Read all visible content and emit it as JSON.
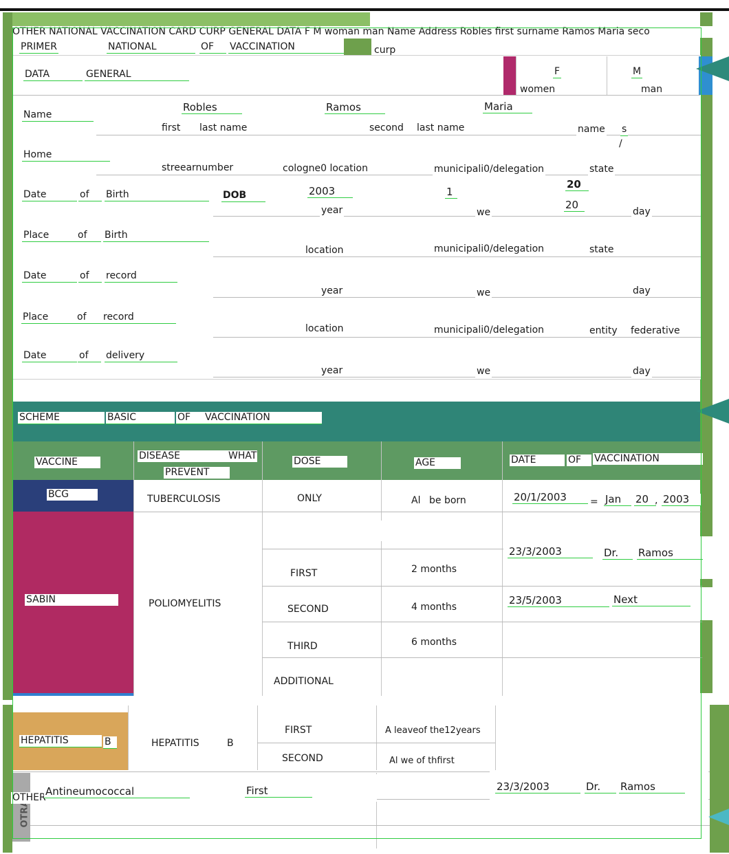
{
  "header": {
    "ocr_line": "OTHER NATIONAL VACCINATION CARD CURP GENERAL DATA F M woman man Name Address Robles first surname Ramos Maria seco",
    "title_words": [
      "PRIMER",
      "NATIONAL",
      "OF",
      "VACCINATION"
    ],
    "curp": "curp"
  },
  "general_data": {
    "label_words": [
      "DATA",
      "GENERAL"
    ],
    "sex_f": "F",
    "sex_m": "M",
    "women": "women",
    "man": "man"
  },
  "name_row": {
    "label": "Name",
    "first_last_name_value": "Robles",
    "second_last_name_value": "Ramos",
    "name_value": "Maria",
    "first": "first",
    "last_name_1": "last name",
    "second": "second",
    "last_name_2": "last name",
    "name": "name",
    "s": "s",
    "slash": "/"
  },
  "home_row": {
    "label": "Home",
    "street_number": "streeаrnumber",
    "cologne_location": "cologne0 location",
    "municipality": "municipali0/delegation",
    "state": "state"
  },
  "dob_row": {
    "words": [
      "Date",
      "of",
      "Birth"
    ],
    "dob": "DOB",
    "year_value": "2003",
    "month_value": "1",
    "day_value_top": "20",
    "day_value_bottom": "20",
    "year": "year",
    "we": "we",
    "day": "day"
  },
  "place_birth_row": {
    "words": [
      "Place",
      "of",
      "Birth"
    ],
    "location": "location",
    "municipality": "municipali0/delegation",
    "state": "state"
  },
  "date_record_row": {
    "words": [
      "Date",
      "of",
      "record"
    ],
    "year": "year",
    "we": "we",
    "day": "day"
  },
  "place_record_row": {
    "words": [
      "Place",
      "of",
      "record"
    ],
    "location": "location",
    "municipality": "municipali0/delegation",
    "entity": "entity",
    "federative": "federative"
  },
  "date_delivery_row": {
    "words": [
      "Date",
      "of",
      "delivery"
    ],
    "year": "year",
    "we": "we",
    "day": "day"
  },
  "scheme": {
    "words": [
      "SCHEME",
      "BASIC",
      "OF",
      "VACCINATION"
    ]
  },
  "table_headers": {
    "vaccine": "VACCINE",
    "disease": "DISEASE",
    "what": "WHAT",
    "prevent": "PREVENT",
    "dose": "DOSE",
    "age": "AGE",
    "date": "DATE",
    "of": "OF",
    "vaccination": "VACCINATION"
  },
  "bcg": {
    "vaccine": "BCG",
    "disease": "TUBERCULOSIS",
    "dose": "ONLY",
    "age_al": "Al",
    "age_rest": "be born",
    "date_value": "20/1/2003",
    "equals": "=",
    "jan": "Jan",
    "twenty": "20",
    "comma": ",",
    "year": "2003"
  },
  "sabin": {
    "vaccine": "SABIN",
    "disease": "POLIOMYELITIS",
    "doses": [
      "FIRST",
      "SECOND",
      "THIRD",
      "ADDITIONAL"
    ],
    "ages": [
      "2 months",
      "4 months",
      "6 months"
    ],
    "first_date": "23/3/2003",
    "first_doctor": "Dr.",
    "first_name": "Ramos",
    "second_date": "23/5/2003",
    "second_note": "Next"
  },
  "hepatitis": {
    "vaccine_word": "HEPATITIS",
    "vaccine_b": "B",
    "disease_word": "HEPATITIS",
    "disease_b": "B",
    "doses": [
      "FIRST",
      "SECOND"
    ],
    "age_first": "A leaveof the12years",
    "age_second": "Al we of thfirst"
  },
  "other": {
    "label": "OTHER",
    "vaccine": "Antineumococcal",
    "dose": "First",
    "date": "23/3/2003",
    "doctor": "Dr.",
    "name": "Ramos",
    "side_label": "OTRA"
  }
}
